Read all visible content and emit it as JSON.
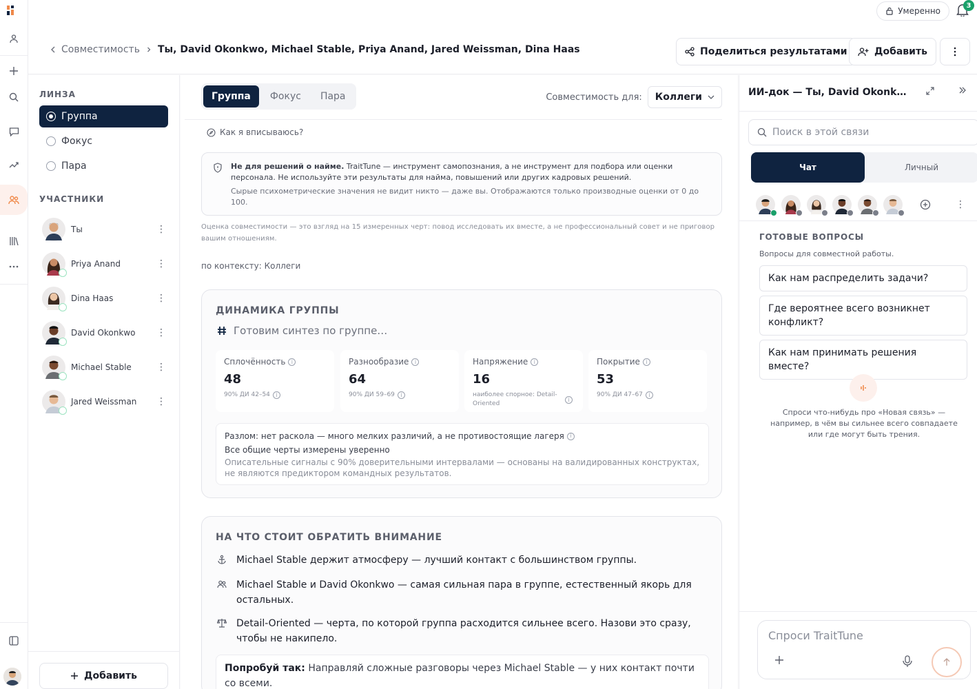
{
  "rail": {
    "icons": [
      "logo-icon",
      "person-icon",
      "plus-icon",
      "search-icon",
      "chat-icon",
      "compare-icon",
      "people-icon",
      "library-icon",
      "more-icon",
      "panel-icon"
    ]
  },
  "header": {
    "mode_label": "Умеренно",
    "notifications_count": "3",
    "back_label": "Совместимость",
    "title": "Ты, David Okonkwo, Michael Stable, Priya Anand, Jared Weissman, Dina Haas",
    "share_label": "Поделиться результатами",
    "add_label": "Добавить"
  },
  "lens": {
    "title": "ЛИНЗА",
    "options": [
      "Группа",
      "Фокус",
      "Пара"
    ],
    "selected": "Группа"
  },
  "participants": {
    "title": "УЧАСТНИКИ",
    "items": [
      "Ты",
      "Priya Anand",
      "Dina Haas",
      "David Okonkwo",
      "Michael Stable",
      "Jared Weissman"
    ],
    "add_label": "Добавить"
  },
  "main": {
    "tabs": [
      "Группа",
      "Фокус",
      "Пара"
    ],
    "compat_label": "Совместимость для:",
    "compat_value": "Коллеги",
    "how_link": "Как я вписываюсь?",
    "note_bold": "Не для решений о найме.",
    "note_text": " TraitTune — инструмент самопознания, а не инструмент для подбора или оценки персонала. Не используйте эти результаты для найма, повышений или других кадровых решений.",
    "note_sub": "Сырые психометрические значения не видит никто — даже вы. Отображаются только производные оценки от 0 до 100.",
    "fine_print": "Оценка совместимости — это взгляд на 15 измеренных черт: повод исследовать их вместе, а не профессиональный совет и не приговор вашим отношениям.",
    "context": "по контексту: Коллеги"
  },
  "dynamics": {
    "title": "ДИНАМИКА ГРУППЫ",
    "synth": "Готовим синтез по группе…",
    "metrics": [
      {
        "label": "Сплочённость",
        "value": "48",
        "sub": "90% ДИ 42–54"
      },
      {
        "label": "Разнообразие",
        "value": "64",
        "sub": "90% ДИ 59–69"
      },
      {
        "label": "Напряжение",
        "value": "16",
        "sub": "наиболее спорное: Detail-Oriented"
      },
      {
        "label": "Покрытие",
        "value": "53",
        "sub": "90% ДИ 47–67"
      }
    ],
    "split_line": "Разлом: нет раскола — много мелких различий, а не противостоящие лагеря",
    "split_line2": "Все общие черты измерены уверенно",
    "split_line3": "Описательные сигналы с 90% доверительными интервалами — основаны на валидированных конструктах, не являются предиктором командных результатов."
  },
  "attention": {
    "title": "НА ЧТО СТОИТ ОБРАТИТЬ ВНИМАНИЕ",
    "items": [
      "Michael Stable держит атмосферу — лучший контакт с большинством группы.",
      "Michael Stable и David Okonkwo — самая сильная пара в группе, естественный якорь для остальных.",
      "Detail-Oriented — черта, по которой группа расходится сильнее всего. Назови это сразу, чтобы не накипело."
    ],
    "try_bold": "Попробуй так:",
    "try_text": " Направляй сложные разговоры через Michael Stable — у них контакт почти со всеми."
  },
  "panel": {
    "title": "ИИ-док — Ты, David Okonkwo, Michael Stable, Priya Anand, Jared Weissman, Dina Haas",
    "search_placeholder": "Поиск в этой связи",
    "seg_chat": "Чат",
    "seg_personal": "Личный",
    "questions_title": "ГОТОВЫЕ ВОПРОСЫ",
    "questions_sub": "Вопросы для совместной работы.",
    "questions": [
      "Как нам распределить задачи?",
      "Где вероятнее всего возникнет конфликт?",
      "Как нам принимать решения вместе?"
    ],
    "hint": "Спроси что-нибудь про «Новая связь» — например, в чём вы сильнее всего совпадаете или где могут быть трения.",
    "composer_placeholder": "Спроси TraitTune"
  },
  "colors": {
    "accent_dark": "#0f2340",
    "online": "#1aa06a",
    "brand_orange": "#f08a4b"
  }
}
